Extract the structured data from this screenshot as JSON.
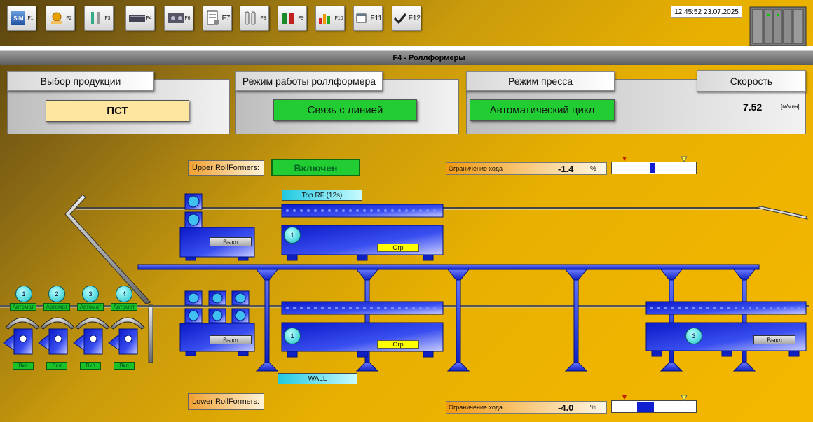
{
  "toolbar": {
    "buttons": [
      {
        "key": "F1",
        "icon": "simatic-icon"
      },
      {
        "key": "F2",
        "icon": "hand-coil-icon"
      },
      {
        "key": "F3",
        "icon": "tools-icon"
      },
      {
        "key": "F4",
        "icon": "rollformer-icon"
      },
      {
        "key": "F6",
        "icon": "machine-icon"
      },
      {
        "key": "F7",
        "icon": "document-settings-icon"
      },
      {
        "key": "F8",
        "icon": "tubes-icon"
      },
      {
        "key": "F9",
        "icon": "alarms-icon"
      },
      {
        "key": "F10",
        "icon": "bar-chart-icon"
      },
      {
        "key": "F11",
        "icon": "window-icon"
      },
      {
        "key": "F12",
        "icon": "checkmark-icon"
      }
    ],
    "simatic_logo": "SIM",
    "clock": "12:45:52  23.07.2025"
  },
  "title": "F4 - Роллформеры",
  "panels": {
    "product": {
      "header": "Выбор продукции",
      "value": "ПСТ"
    },
    "rollformer_mode": {
      "header": "Режим работы роллформера",
      "value": "Связь с линией"
    },
    "press_mode": {
      "header": "Режим пресса",
      "value": "Автоматический цикл"
    },
    "speed": {
      "header": "Скорость",
      "value": "7.52",
      "unit": "[м/мин]"
    }
  },
  "upper": {
    "label": "Upper RollFormers:",
    "status": "Включен",
    "limit_label": "Ограничение хода",
    "limit_value": "-1.4",
    "limit_unit": "%",
    "gauge_fraction": 0.45,
    "top_rf": "Top RF (12s)",
    "state_off": "Выкл",
    "limit_tag": "Огр",
    "unit_number": "1"
  },
  "lower": {
    "label": "Lower RollFormers:",
    "limit_label": "Ограничение хода",
    "limit_value": "-4.0",
    "limit_unit": "%",
    "gauge_fraction": 0.3,
    "wall": "WALL",
    "state_off": "Выкл",
    "limit_tag": "Огр",
    "unit_number": "1",
    "right_unit_number": "3",
    "right_state": "Выкл"
  },
  "decoilers": [
    {
      "num": "1",
      "mode": "Автомат",
      "state": "Вкл"
    },
    {
      "num": "2",
      "mode": "Автомат",
      "state": "Вкл"
    },
    {
      "num": "3",
      "mode": "Автомат",
      "state": "Вкл"
    },
    {
      "num": "4",
      "mode": "Автомат",
      "state": "Вкл"
    }
  ],
  "colors": {
    "machine_blue": "#1a2bd8",
    "status_green": "#22cc33",
    "limit_yellow": "#ffff00",
    "cyan": "#20c8e0"
  }
}
